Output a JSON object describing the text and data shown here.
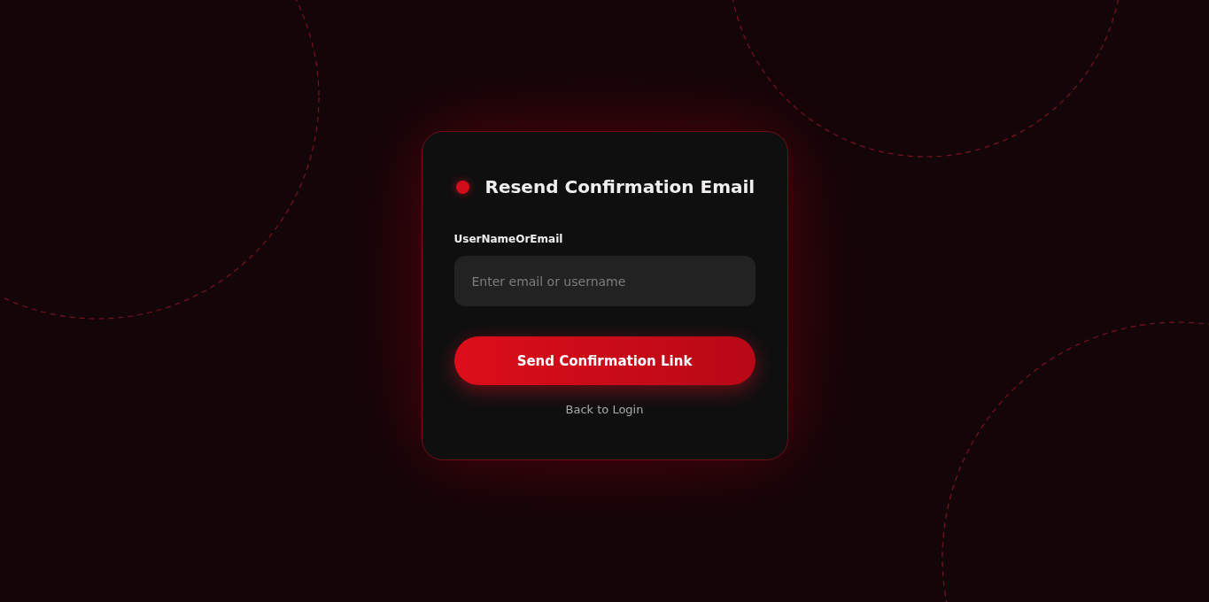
{
  "card": {
    "title": "Resend Confirmation Email",
    "field": {
      "label": "UserNameOrEmail",
      "placeholder": "Enter email or username"
    },
    "submit_button": "Send Confirmation Link",
    "back_link": "Back to Login"
  }
}
